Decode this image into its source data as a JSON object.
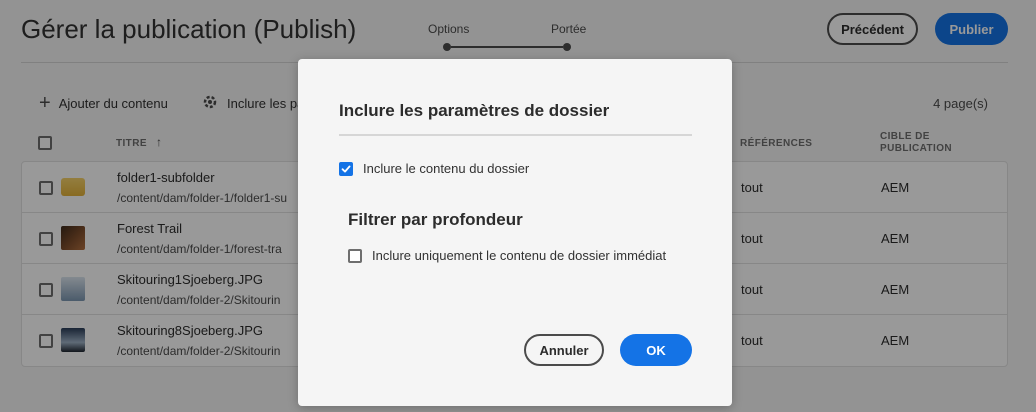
{
  "header": {
    "title": "Gérer la publication (Publish)",
    "steps": [
      "Options",
      "Portée"
    ],
    "prev_button": "Précédent",
    "publish_button": "Publier"
  },
  "actionbar": {
    "add_content": "Ajouter du contenu",
    "include_settings": "Inclure les pa",
    "page_count": "4 page(s)"
  },
  "table": {
    "col_title": "TITRE",
    "col_references": "RÉFÉRENCES",
    "col_target": "CIBLE DE PUBLICATION",
    "rows": [
      {
        "name": "folder1-subfolder",
        "path": "/content/dam/folder-1/folder1-su",
        "references": "tout",
        "target": "AEM"
      },
      {
        "name": "Forest Trail",
        "path": "/content/dam/folder-1/forest-tra",
        "references": "tout",
        "target": "AEM"
      },
      {
        "name": "Skitouring1Sjoeberg.JPG",
        "path": "/content/dam/folder-2/Skitourin",
        "references": "tout",
        "target": "AEM"
      },
      {
        "name": "Skitouring8Sjoeberg.JPG",
        "path": "/content/dam/folder-2/Skitourin",
        "references": "tout",
        "target": "AEM"
      }
    ]
  },
  "dialog": {
    "title": "Inclure les paramètres de dossier",
    "include_folder_content": "Inclure le contenu du dossier",
    "include_folder_content_checked": true,
    "filter_heading": "Filtrer par profondeur",
    "immediate_only": "Inclure uniquement le contenu de dossier immédiat",
    "immediate_only_checked": false,
    "cancel": "Annuler",
    "ok": "OK"
  },
  "colors": {
    "accent": "#1473e6",
    "background": "#f5f5f5"
  }
}
